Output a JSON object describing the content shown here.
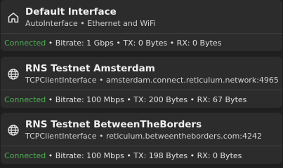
{
  "interfaces": [
    {
      "name": "Default Interface",
      "subtitle": "AutoInterface • Ethernet and WiFi",
      "icon": "home-icon",
      "status": "Connected",
      "stats": " • Bitrate: 1 Gbps • TX: 0 Bytes • RX: 0 Bytes"
    },
    {
      "name": "RNS Testnet Amsterdam",
      "subtitle": "TCPClientInterface • amsterdam.connect.reticulum.network:4965",
      "icon": "globe-icon",
      "status": "Connected",
      "stats": " • Bitrate: 100 Mbps • TX: 200 Bytes • RX: 67 Bytes"
    },
    {
      "name": "RNS Testnet BetweenTheBorders",
      "subtitle": "TCPClientInterface • reticulum.betweentheborders.com:4242",
      "icon": "globe-icon",
      "status": "Connected",
      "stats": " • Bitrate: 100 Mbps • TX: 198 Bytes • RX: 0 Bytes"
    }
  ],
  "colors": {
    "background": "#1f1f1f",
    "card": "#2c2c2c",
    "status_connected": "#4caf50"
  }
}
